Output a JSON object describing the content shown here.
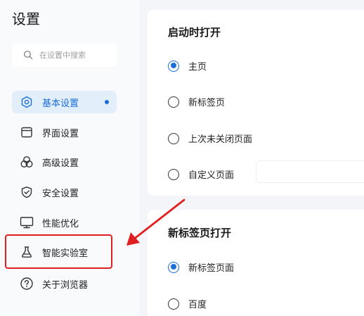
{
  "sidebar": {
    "title": "设置",
    "search_placeholder": "在设置中搜索",
    "items": [
      {
        "label": "基本设置",
        "icon": "hexagon-gear-icon",
        "active": true
      },
      {
        "label": "界面设置",
        "icon": "window-icon"
      },
      {
        "label": "高级设置",
        "icon": "circles-icon"
      },
      {
        "label": "安全设置",
        "icon": "shield-icon"
      },
      {
        "label": "性能优化",
        "icon": "monitor-icon"
      },
      {
        "label": "智能实验室",
        "icon": "flask-icon"
      },
      {
        "label": "关于浏览器",
        "icon": "question-circle-icon"
      }
    ]
  },
  "startup": {
    "title": "启动时打开",
    "options": [
      "主页",
      "新标签页",
      "上次未关闭页面",
      "自定义页面"
    ],
    "selected": "主页"
  },
  "new_tab": {
    "title": "新标签页打开",
    "options": [
      "新标签页面",
      "百度"
    ],
    "selected": "新标签页面"
  },
  "colors": {
    "accent": "#1a6fd8",
    "annotation_red": "#e02020"
  }
}
